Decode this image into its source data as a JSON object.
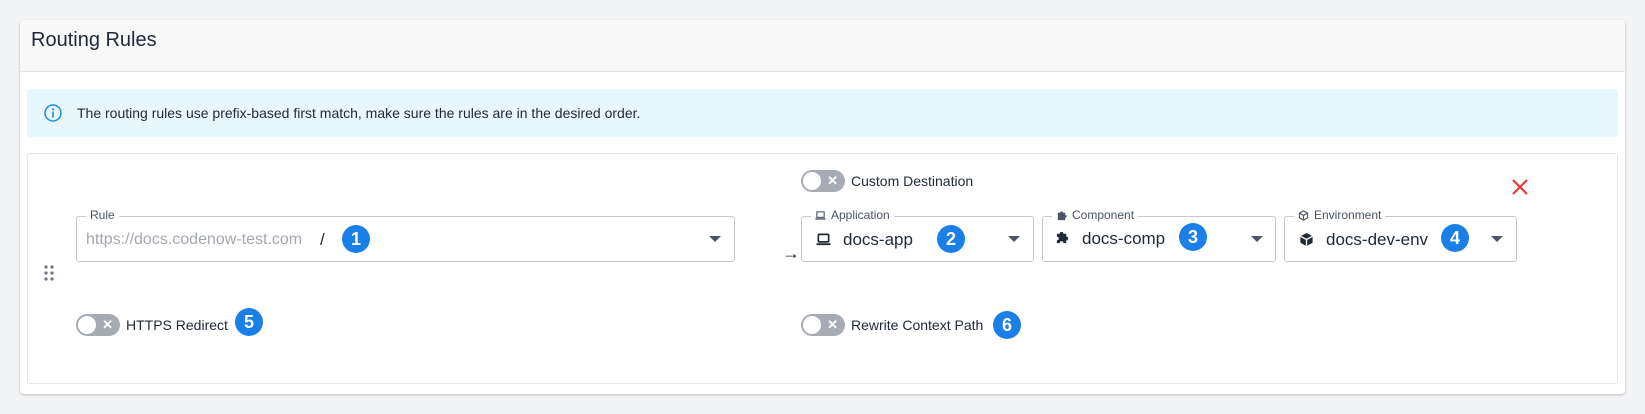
{
  "header": {
    "title": "Routing Rules"
  },
  "info": {
    "icon": "info-icon",
    "text": "The routing rules use prefix-based first match, make sure the rules are in the desired order."
  },
  "rule": {
    "label": "Rule",
    "placeholder": "https://docs.codenow-test.com",
    "separator": "/",
    "badge": "1"
  },
  "arrow": "→",
  "custom_destination": {
    "label": "Custom Destination",
    "enabled": false
  },
  "application": {
    "label": "Application",
    "value": "docs-app",
    "icon": "laptop-icon",
    "badge": "2"
  },
  "component": {
    "label": "Component",
    "value": "docs-comp",
    "icon": "puzzle-icon",
    "badge": "3"
  },
  "environment": {
    "label": "Environment",
    "value": "docs-dev-env",
    "icon": "cube-icon",
    "badge": "4"
  },
  "https_redirect": {
    "label": "HTTPS Redirect",
    "enabled": false,
    "badge": "5"
  },
  "rewrite_context": {
    "label": "Rewrite Context Path",
    "enabled": false,
    "badge": "6"
  },
  "colors": {
    "accent": "#1a7fe6",
    "danger": "#e53935",
    "info_bg": "#e8f6fd",
    "toggle_off": "#a7abb3"
  }
}
